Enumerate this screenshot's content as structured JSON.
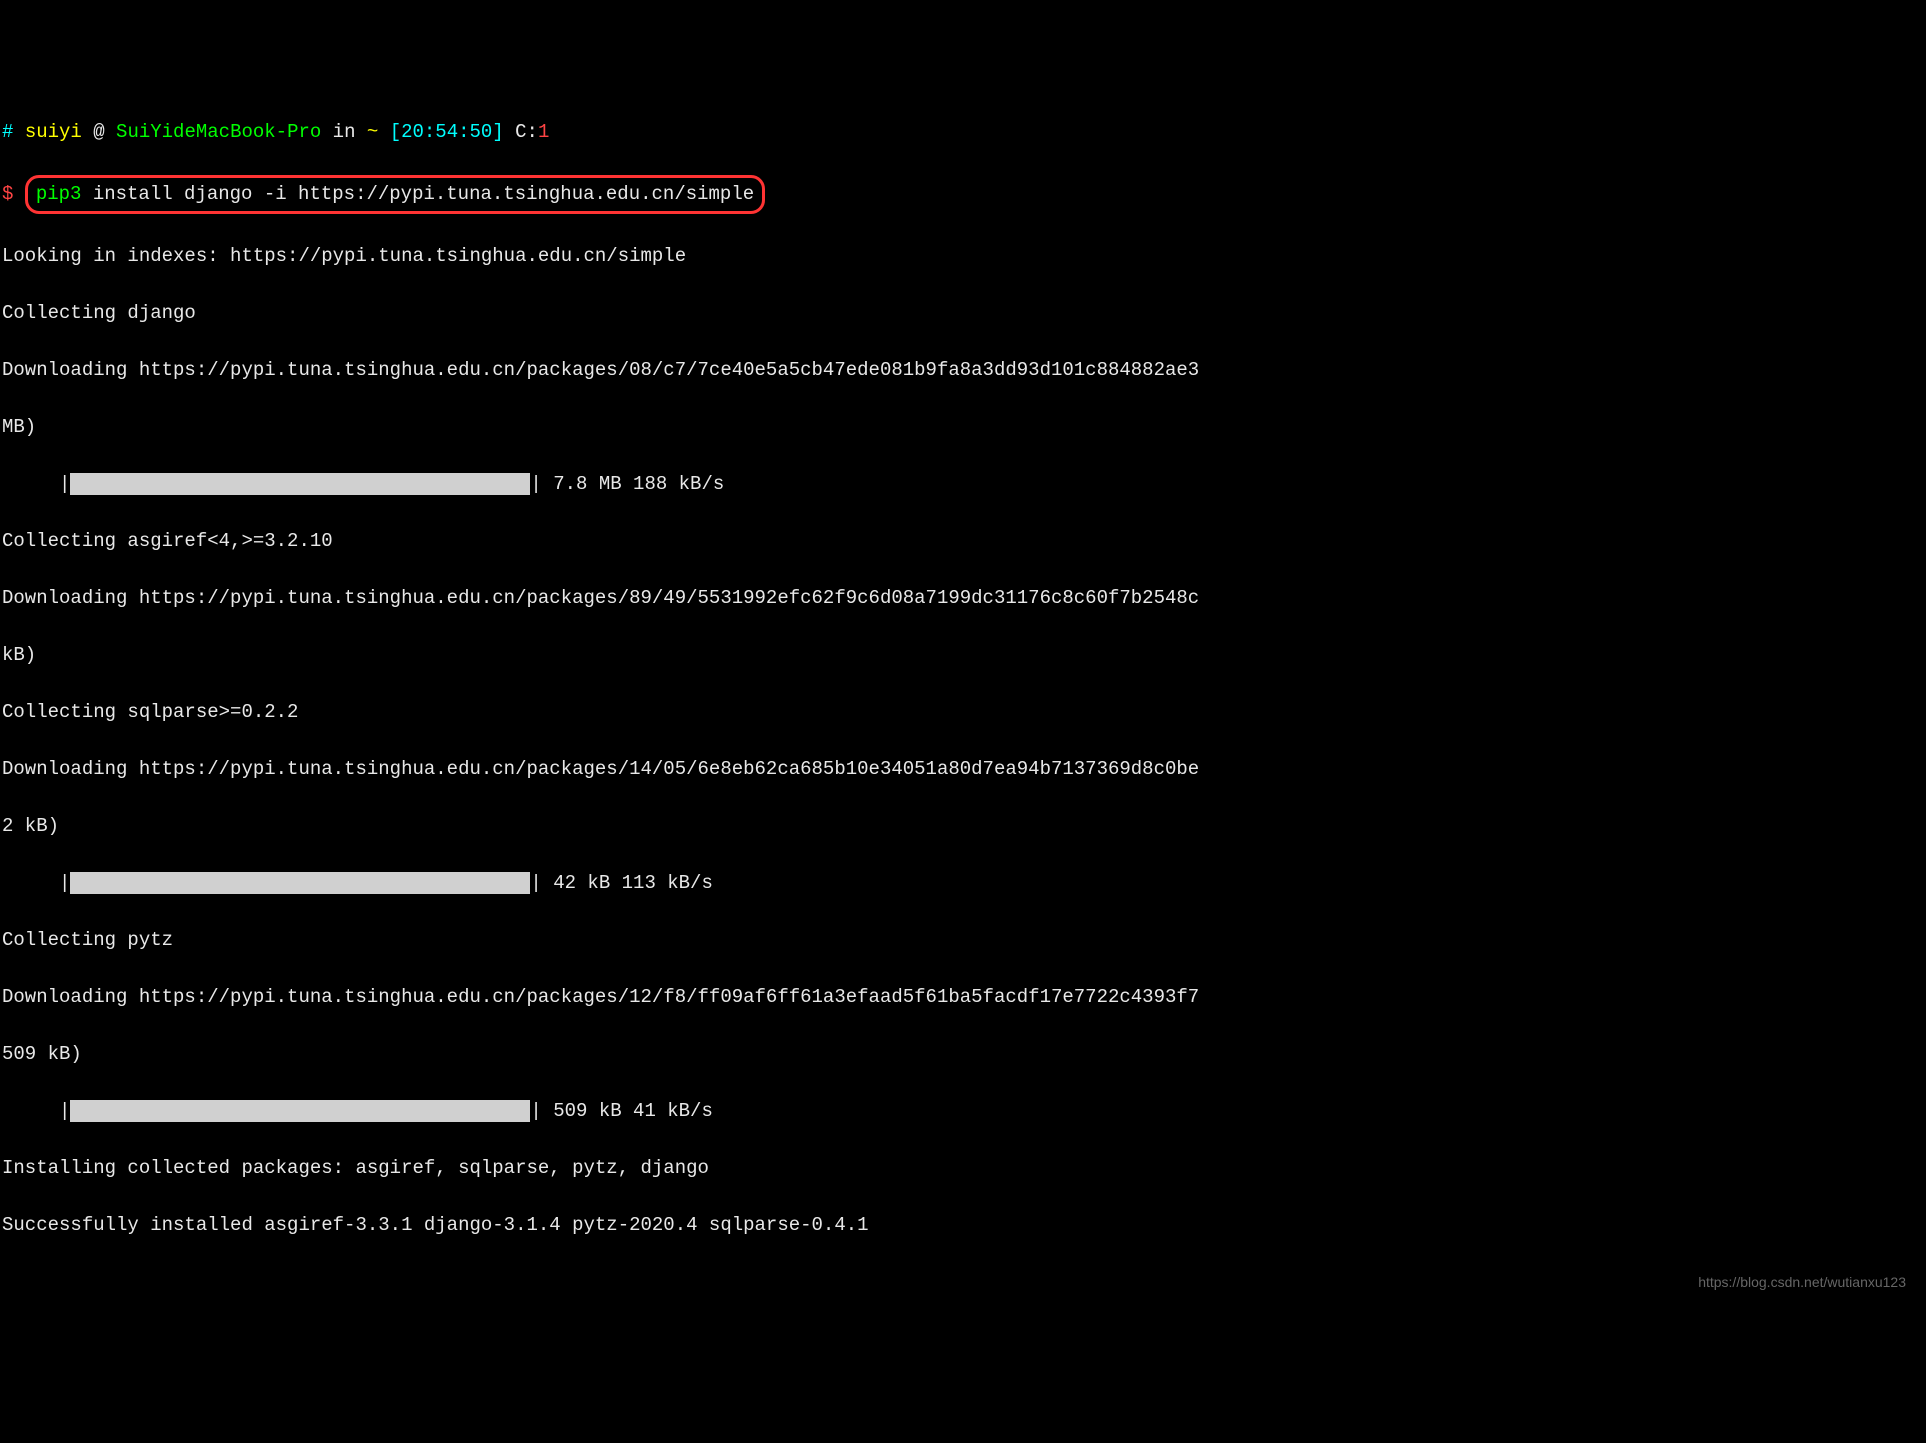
{
  "prompt1": {
    "hash": "# ",
    "user": "suiyi",
    "at": " @ ",
    "host": "SuiYideMacBook-Pro",
    "in_word": " in ",
    "path": "~",
    "time": " [20:54:50] ",
    "c_label": "C:",
    "c_val": "1"
  },
  "prompt2": {
    "dollar": "$ ",
    "cmd_green": "pip3",
    "cmd_white": " install django -i https://pypi.tuna.tsinghua.edu.cn/simple"
  },
  "output": {
    "l1": "Looking in indexes: https://pypi.tuna.tsinghua.edu.cn/simple",
    "l2": "Collecting django",
    "l3": "  Downloading https://pypi.tuna.tsinghua.edu.cn/packages/08/c7/7ce40e5a5cb47ede081b9fa8a3dd93d101c884882ae3",
    "l4": "MB)",
    "p1_prefix": "     |",
    "p1_suffix": "| 7.8 MB 188 kB/s",
    "l5": "Collecting asgiref<4,>=3.2.10",
    "l6": "  Downloading https://pypi.tuna.tsinghua.edu.cn/packages/89/49/5531992efc62f9c6d08a7199dc31176c8c60f7b2548c",
    "l7": " kB)",
    "l8": "Collecting sqlparse>=0.2.2",
    "l9": "  Downloading https://pypi.tuna.tsinghua.edu.cn/packages/14/05/6e8eb62ca685b10e34051a80d7ea94b7137369d8c0be",
    "l10": "2 kB)",
    "p2_prefix": "     |",
    "p2_suffix": "| 42 kB 113 kB/s",
    "l11": "Collecting pytz",
    "l12": "  Downloading https://pypi.tuna.tsinghua.edu.cn/packages/12/f8/ff09af6ff61a3efaad5f61ba5facdf17e7722c4393f7",
    "l13": "509 kB)",
    "p3_prefix": "     |",
    "p3_suffix": "| 509 kB 41 kB/s",
    "l14": "Installing collected packages: asgiref, sqlparse, pytz, django",
    "l15": "Successfully installed asgiref-3.3.1 django-3.1.4 pytz-2020.4 sqlparse-0.4.1"
  },
  "watermark": "https://blog.csdn.net/wutianxu123"
}
